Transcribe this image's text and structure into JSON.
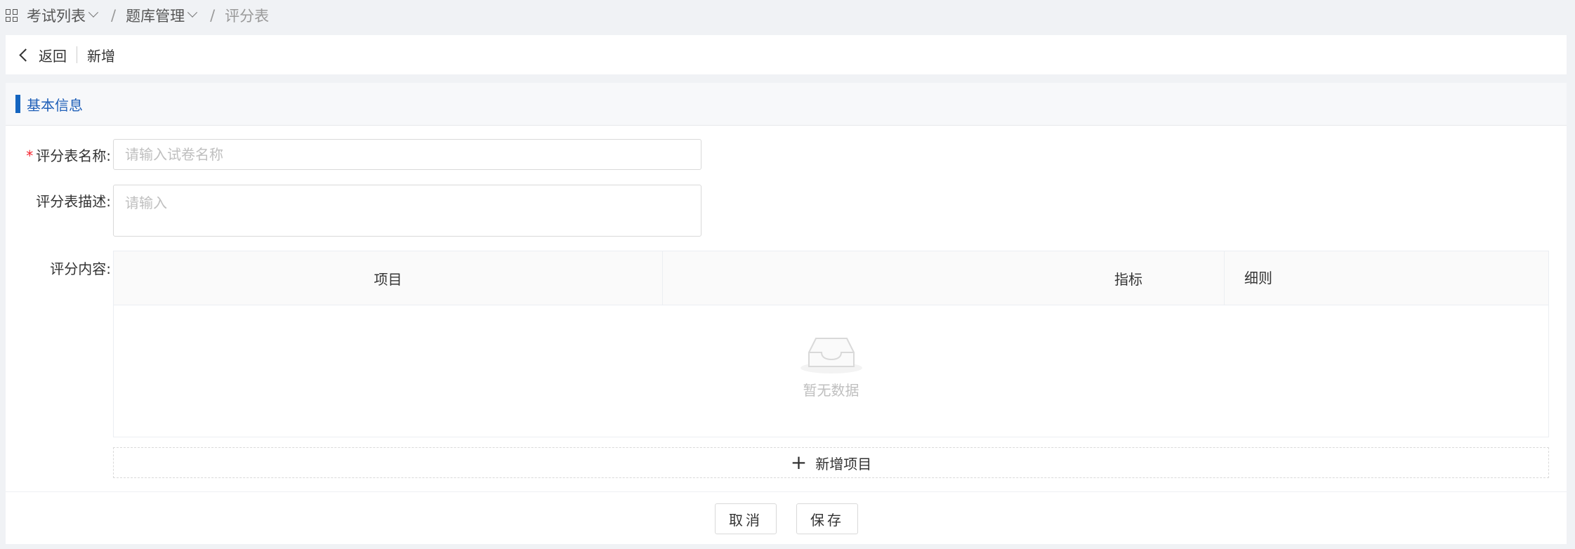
{
  "breadcrumb": {
    "items": [
      "考试列表",
      "题库管理"
    ],
    "separator": "/",
    "current": "评分表"
  },
  "header": {
    "back_label": "返回",
    "page_title": "新增"
  },
  "section": {
    "title": "基本信息"
  },
  "form": {
    "name_label": "评分表名称:",
    "name_placeholder": "请输入试卷名称",
    "desc_label": "评分表描述:",
    "desc_placeholder": "请输入",
    "content_label": "评分内容:"
  },
  "table": {
    "columns": [
      "项目",
      "指标",
      "细则"
    ],
    "empty_text": "暂无数据"
  },
  "add_item_label": "新增项目",
  "actions": {
    "cancel": "取消",
    "save": "保存"
  },
  "colors": {
    "accent": "#1565c0",
    "required": "#f5222d"
  }
}
